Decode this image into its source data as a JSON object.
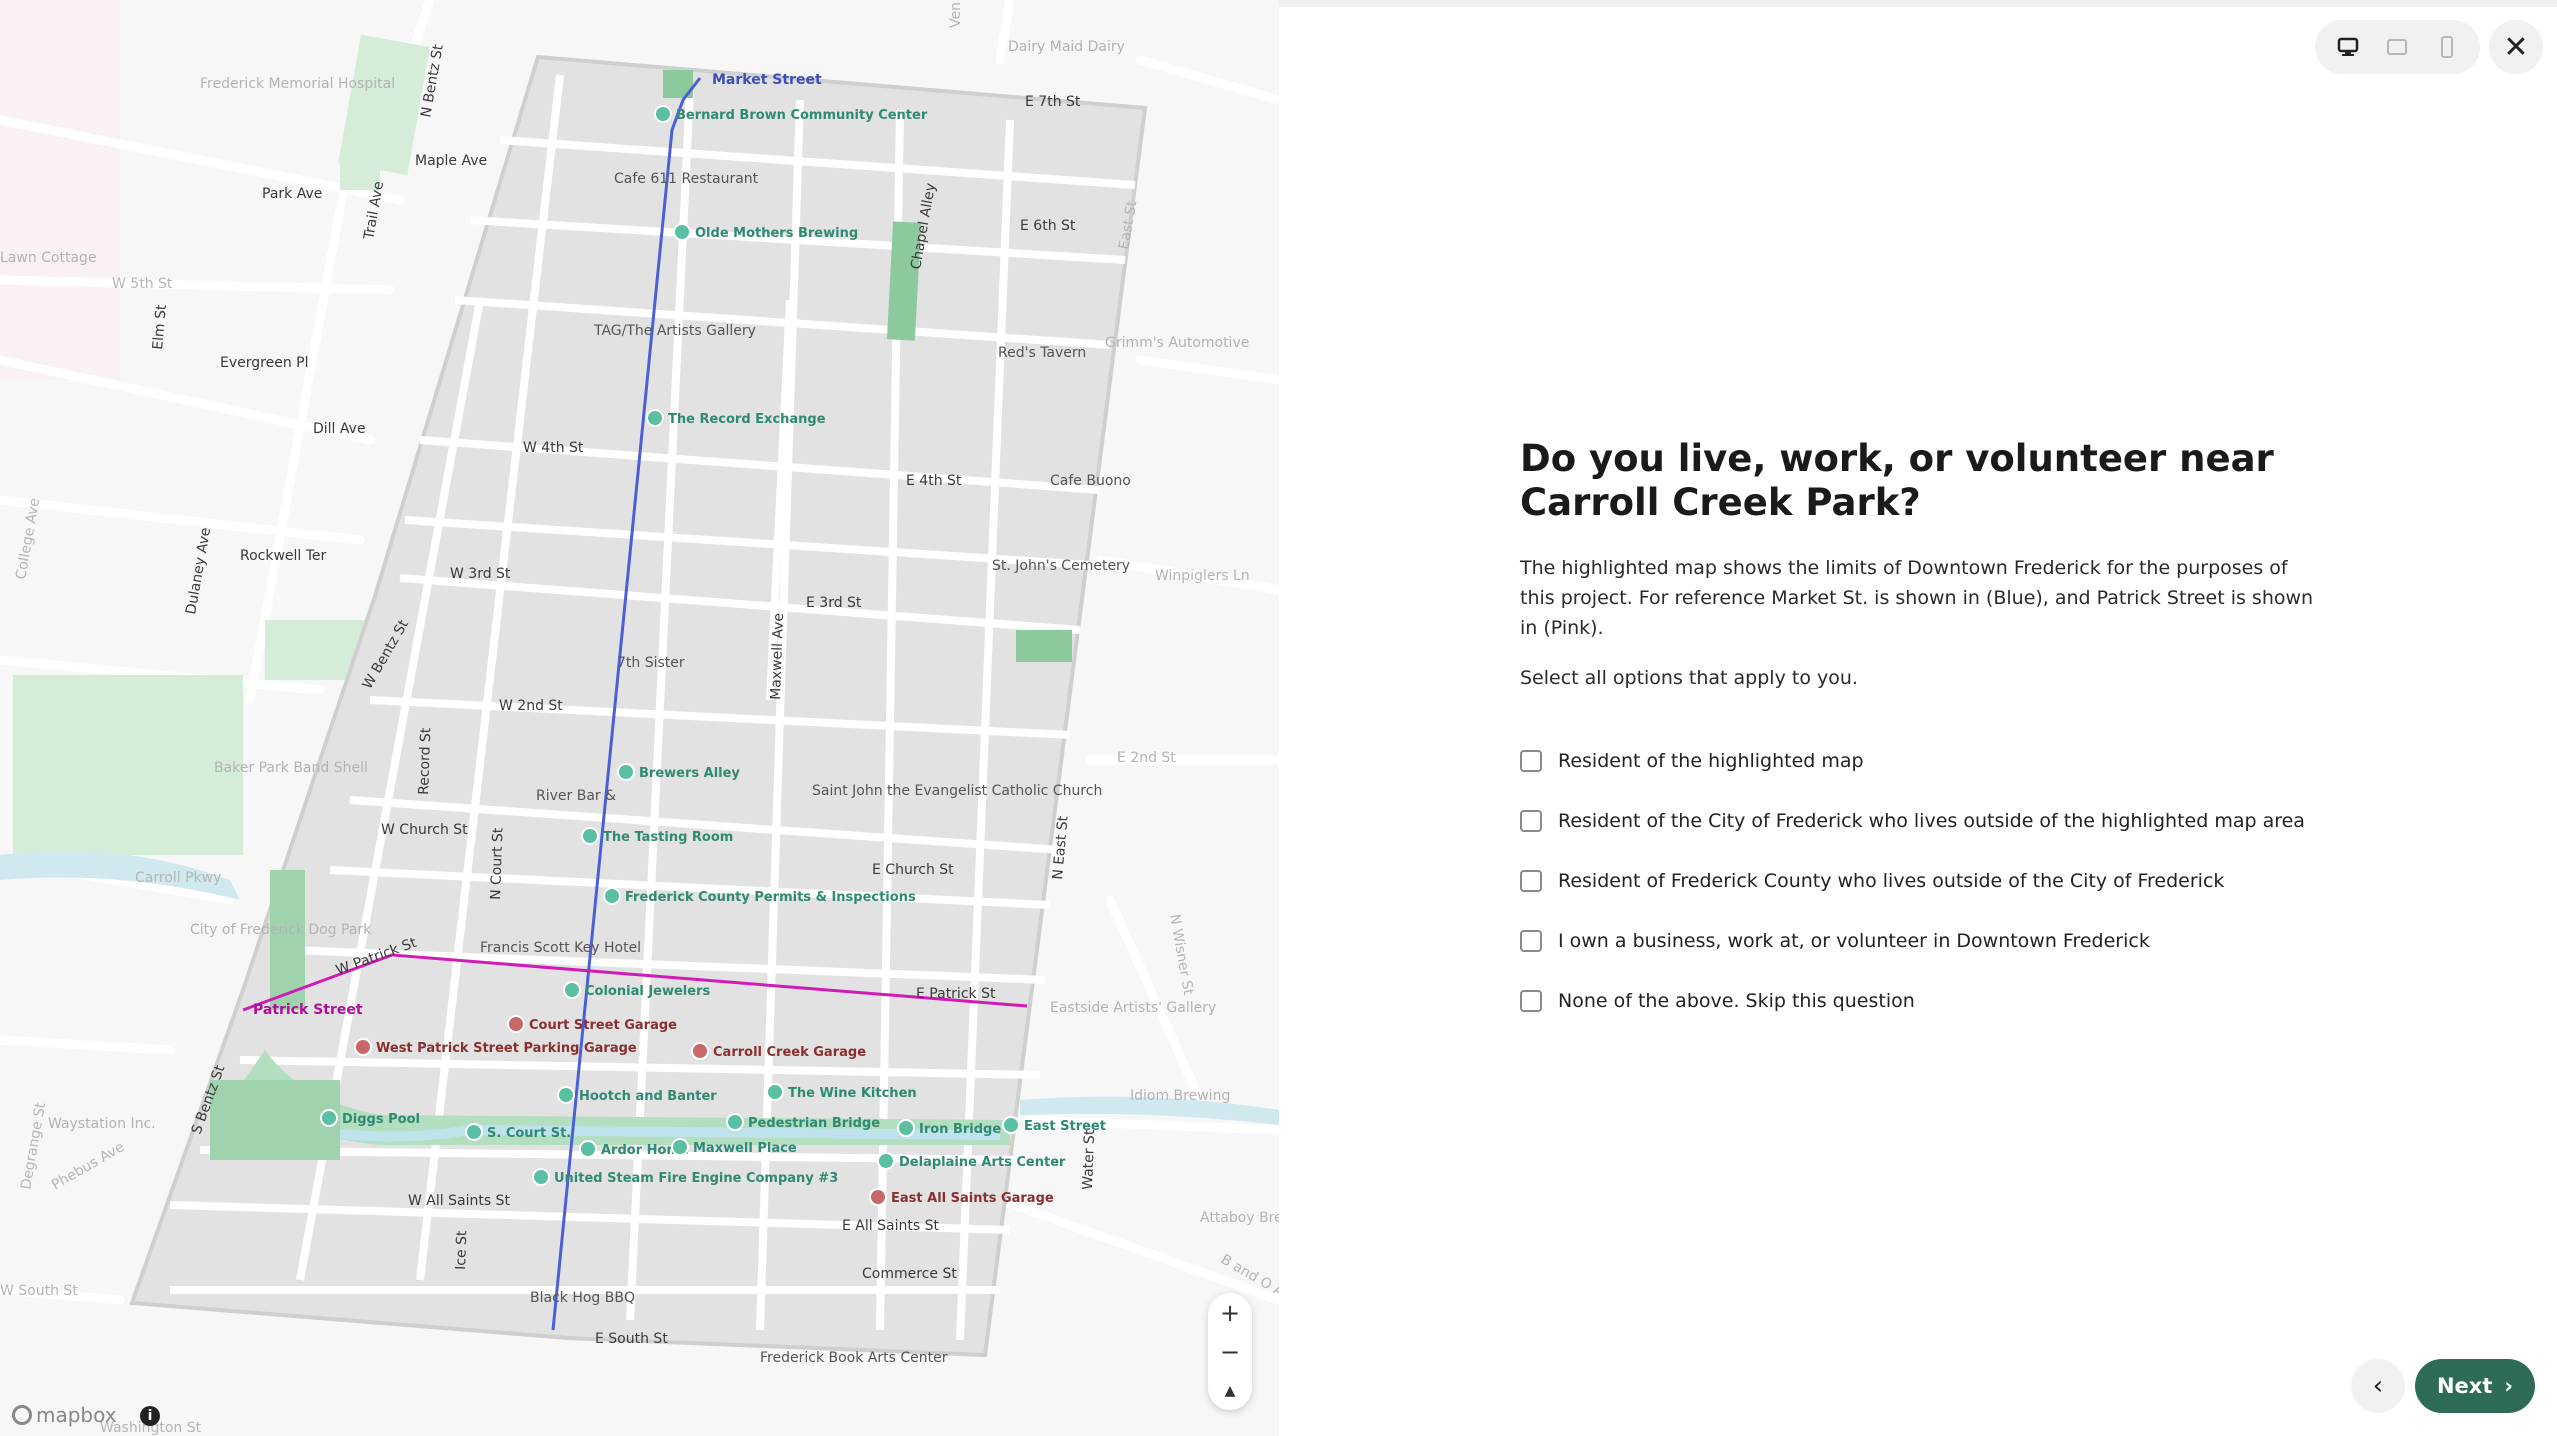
{
  "progress": {
    "percent": 5
  },
  "map": {
    "attribution_logo": "mapbox",
    "info_icon": "i",
    "zoom_in": "+",
    "zoom_out": "−",
    "compass": "▲",
    "routes": {
      "market": {
        "label": "Market Street",
        "color": "#4a5fd8"
      },
      "patrick": {
        "label": "Patrick Street",
        "color": "#d11bb6"
      }
    },
    "teal_places": [
      "Bernard Brown Community Center",
      "Olde Mothers Brewing",
      "The Record Exchange",
      "Brewers Alley",
      "The Tasting Room",
      "Frederick County Permits & Inspections",
      "Colonial Jewelers",
      "Hootch and Banter",
      "The Wine Kitchen",
      "Pedestrian Bridge",
      "Diggs Pool",
      "S. Court St.",
      "Ardor Home",
      "Maxwell Place",
      "United Steam Fire Engine Company #3",
      "Iron Bridge",
      "East Street",
      "Delaplaine Arts Center"
    ],
    "red_places": [
      "Court Street Garage",
      "West Patrick Street Parking Garage",
      "Carroll Creek Garage",
      "East All Saints Garage"
    ],
    "poi_labels": [
      "Cafe 611 Restaurant",
      "TAG/The Artists Gallery",
      "Red's Tavern",
      "Cafe Buono",
      "St. John's Cemetery",
      "7th Sister",
      "River Bar &",
      "Saint John the Evangelist Catholic Church",
      "Francis Scott Key Hotel",
      "Black Hog BBQ",
      "Frederick Book Arts Center",
      "Frederick Memorial Hospital",
      "Dairy Maid Dairy",
      "Grimm's Automotive",
      "Baker Park Band Shell",
      "City of Frederick Dog Park",
      "Eastside Artists' Gallery",
      "Idiom Brewing",
      "Waystation Inc.",
      "Lawn Cottage"
    ],
    "street_labels": [
      "E 7th St",
      "E 6th St",
      "Chapel Alley",
      "East St",
      "W 5th St",
      "Evergreen Pl",
      "Dill Ave",
      "W 4th St",
      "E 4th St",
      "Rockwell Ter",
      "W 3rd St",
      "E 3rd St",
      "Winpiglers Ln",
      "Maxwell Ave",
      "W 2nd St",
      "E 2nd St",
      "Record St",
      "W Church St",
      "N Court St",
      "E Church St",
      "N East St",
      "Carroll Pkwy",
      "W Patrick St",
      "E Patrick St",
      "W All Saints St",
      "E All Saints St",
      "Ice St",
      "Commerce St",
      "E South St",
      "W South St",
      "Water St",
      "Attaboy Bre",
      "B and O Av",
      "N Bentz St",
      "Maple Ave",
      "Park Ave",
      "Trail Ave",
      "Elm St",
      "College Ave",
      "Dulaney Ave",
      "W Bentz St",
      "S Bentz St",
      "Degrange St",
      "Phebus Ave",
      "N Wisner St",
      "Washington St",
      "Ven"
    ]
  },
  "toolbar": {
    "desktop_icon": "desktop-view",
    "tablet_icon": "tablet-view",
    "mobile_icon": "mobile-view",
    "close": "✕"
  },
  "question": {
    "title": "Do you live, work, or volunteer near Carroll Creek Park?",
    "description": "The highlighted map shows the limits of Downtown Frederick for the purposes of this project. For reference Market St. is shown in (Blue), and Patrick Street is shown in (Pink).",
    "hint": "Select all options that apply to you.",
    "options": [
      {
        "label": "Resident of the highlighted map",
        "checked": false
      },
      {
        "label": "Resident of the City of Frederick who lives outside of the highlighted map area",
        "checked": false
      },
      {
        "label": "Resident of Frederick County who lives outside of the City of Frederick",
        "checked": false
      },
      {
        "label": "I own a business, work at, or volunteer in Downtown Frederick",
        "checked": false
      },
      {
        "label": "None of the above. Skip this question",
        "checked": false
      }
    ]
  },
  "nav": {
    "back": "‹",
    "next": "Next",
    "next_arrow": "›"
  },
  "colors": {
    "accent": "#2e6b57",
    "teal_pin": "#5bbfa4",
    "red_pin": "#c96868",
    "park": "#7cc79a"
  }
}
